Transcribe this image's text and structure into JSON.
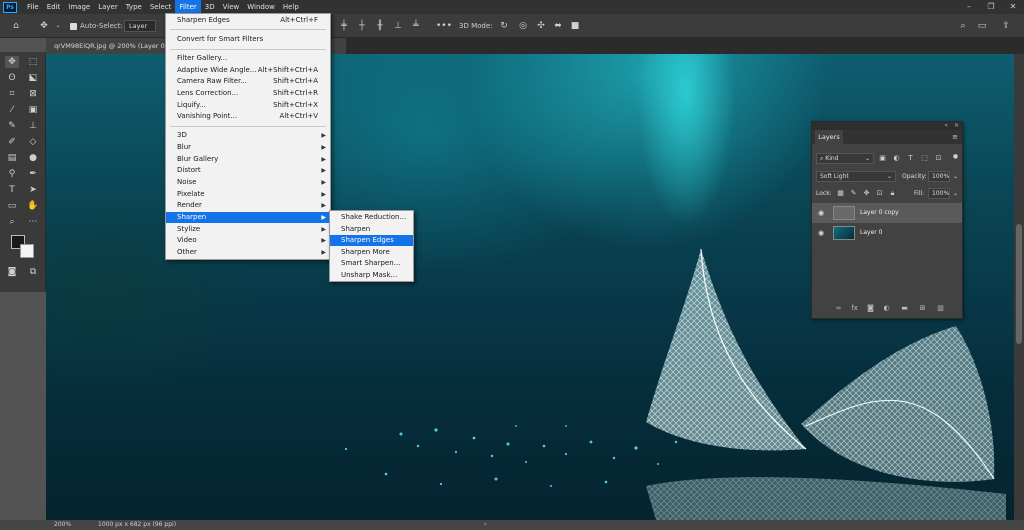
{
  "menubar": {
    "logo": "Ps",
    "items": [
      "File",
      "Edit",
      "Image",
      "Layer",
      "Type",
      "Select",
      "Filter",
      "3D",
      "View",
      "Window",
      "Help"
    ],
    "active": "Filter",
    "window_controls": [
      "–",
      "❐",
      "✕"
    ]
  },
  "options_bar": {
    "auto_select_label": "Auto-Select:",
    "layer_select_value": "Layer",
    "mode_3d_label": "3D Mode:"
  },
  "document": {
    "tab_title": "qrVM98EiQR.jpg @ 200% (Layer 0 copy, RGB/8#) *",
    "zoom": "200%",
    "doc_info": "1000 px x 682 px (96 ppi)"
  },
  "filter_menu": {
    "top_items": [
      {
        "label": "Sharpen Edges",
        "shortcut": "Alt+Ctrl+F"
      },
      {
        "label": "Convert for Smart Filters",
        "shortcut": ""
      }
    ],
    "filter_items": [
      {
        "label": "Filter Gallery...",
        "shortcut": ""
      },
      {
        "label": "Adaptive Wide Angle...",
        "shortcut": "Alt+Shift+Ctrl+A"
      },
      {
        "label": "Camera Raw Filter...",
        "shortcut": "Shift+Ctrl+A"
      },
      {
        "label": "Lens Correction...",
        "shortcut": "Shift+Ctrl+R"
      },
      {
        "label": "Liquify...",
        "shortcut": "Shift+Ctrl+X"
      },
      {
        "label": "Vanishing Point...",
        "shortcut": "Alt+Ctrl+V"
      }
    ],
    "submenus": [
      "3D",
      "Blur",
      "Blur Gallery",
      "Distort",
      "Noise",
      "Pixelate",
      "Render",
      "Sharpen",
      "Stylize",
      "Video",
      "Other"
    ],
    "highlighted": "Sharpen"
  },
  "sharpen_submenu": {
    "items": [
      "Shake Reduction...",
      "Sharpen",
      "Sharpen Edges",
      "Sharpen More",
      "Smart Sharpen...",
      "Unsharp Mask..."
    ],
    "highlighted": "Sharpen Edges"
  },
  "layers_panel": {
    "tab": "Layers",
    "kind_label": "Kind",
    "blend_mode": "Soft Light",
    "opacity_label": "Opacity:",
    "opacity_value": "100%",
    "lock_label": "Lock:",
    "fill_label": "Fill:",
    "fill_value": "100%",
    "layers": [
      {
        "name": "Layer 0 copy",
        "selected": true
      },
      {
        "name": "Layer 0",
        "selected": false
      }
    ],
    "footer_icons": [
      "link-icon",
      "fx-icon",
      "mask-icon",
      "adjustment-icon",
      "folder-icon",
      "new-layer-icon",
      "trash-icon"
    ]
  },
  "colors": {
    "menu_highlight": "#1473e6",
    "app_bg": "#535353",
    "panel_bg": "#424242"
  }
}
